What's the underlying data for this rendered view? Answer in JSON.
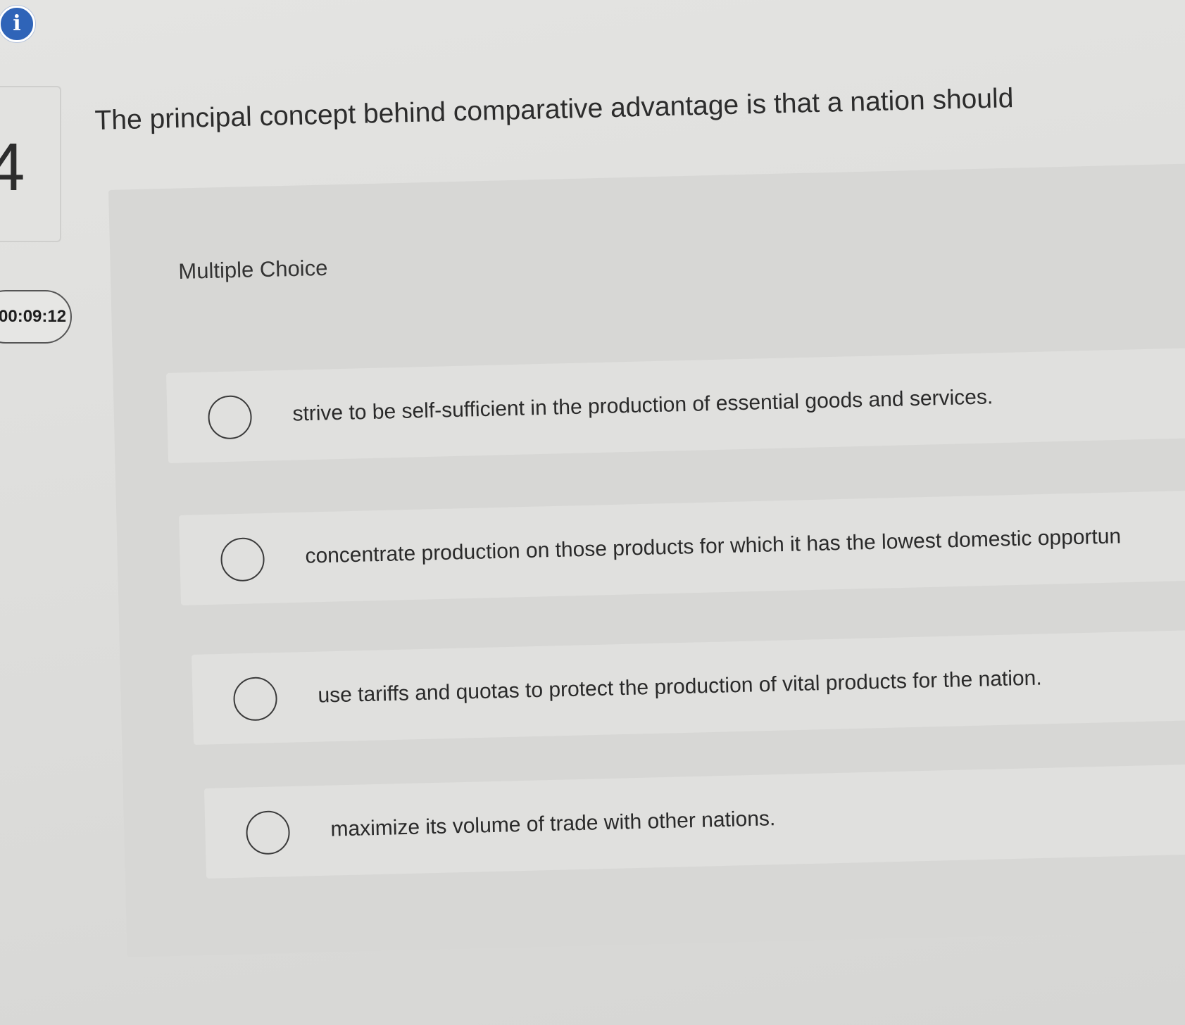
{
  "sidebar": {
    "info_icon_glyph": "i",
    "question_number": "4",
    "timer": "00:09:12"
  },
  "question": {
    "prompt": "The principal concept behind comparative advantage is that a nation should",
    "type_label": "Multiple Choice",
    "options": [
      {
        "label": "strive to be self-sufficient in the production of essential goods and services."
      },
      {
        "label": "concentrate production on those products for which it has the lowest domestic opportun"
      },
      {
        "label": "use tariffs and quotas to protect the production of vital products for the nation."
      },
      {
        "label": "maximize its volume of trade with other nations."
      }
    ]
  },
  "colors": {
    "accent": "#2f64b8",
    "background": "#dcdcda",
    "text": "#2b2b2b"
  }
}
